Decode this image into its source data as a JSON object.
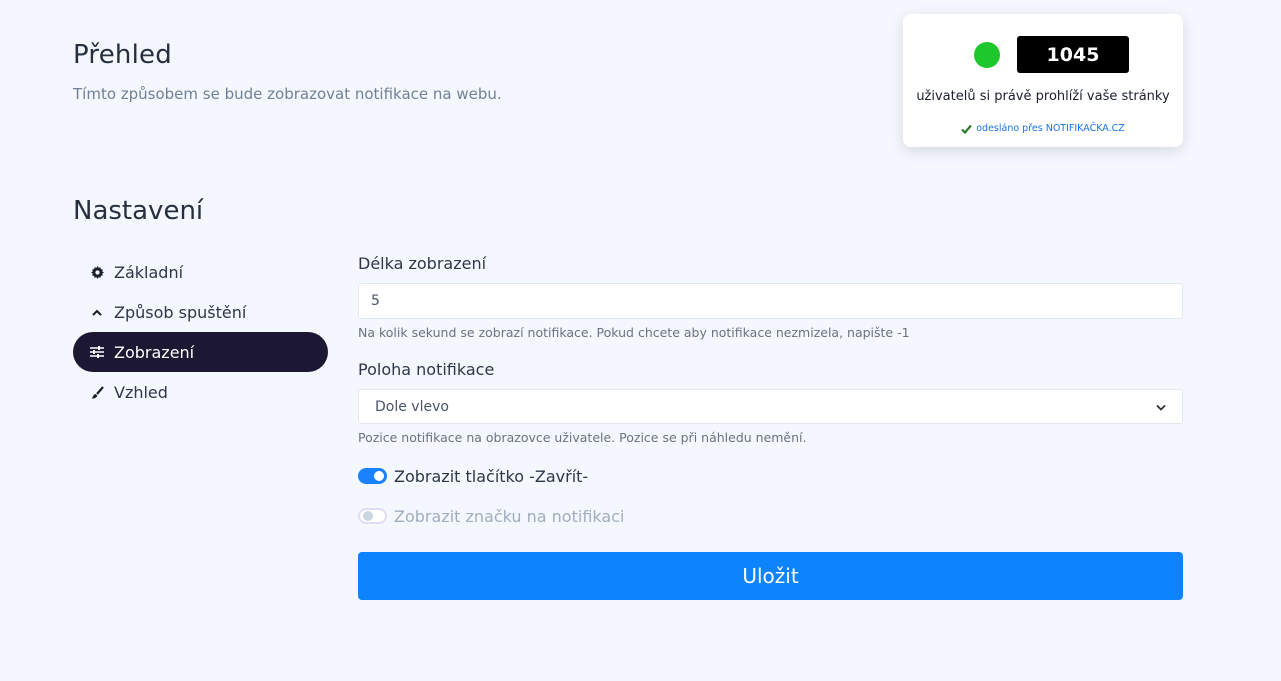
{
  "overview": {
    "title": "Přehled",
    "subtitle": "Tímto způsobem se bude zobrazovat notifikace na webu."
  },
  "widget": {
    "count": "1045",
    "text": "uživatelů si právě prohlíží vaše stránky",
    "footer": "odesláno přes NOTIFIKAČKA.CZ",
    "dot_color": "#1ec72b"
  },
  "settings": {
    "title": "Nastavení"
  },
  "sidebar": {
    "items": [
      {
        "label": "Základní",
        "icon": "gear-icon",
        "active": false
      },
      {
        "label": "Způsob spuštění",
        "icon": "chevron-up-icon",
        "active": false
      },
      {
        "label": "Zobrazení",
        "icon": "sliders-icon",
        "active": true
      },
      {
        "label": "Vzhled",
        "icon": "brush-icon",
        "active": false
      }
    ]
  },
  "form": {
    "duration": {
      "label": "Délka zobrazení",
      "value": "5",
      "help": "Na kolik sekund se zobrazí notifikace. Pokud chcete aby notifikace nezmizela, napište -1"
    },
    "position": {
      "label": "Poloha notifikace",
      "value": "Dole vlevo",
      "help": "Pozice notifikace na obrazovce uživatele. Pozice se při náhledu nemění."
    },
    "toggle_close": {
      "label": "Zobrazit tlačítko -Zavřít-",
      "checked": true
    },
    "toggle_badge": {
      "label": "Zobrazit značku na notifikaci",
      "checked": false
    },
    "save_label": "Uložit"
  },
  "colors": {
    "accent": "#0d83fd",
    "sidebar_active": "#1c1733",
    "background": "#f4f7fe"
  }
}
